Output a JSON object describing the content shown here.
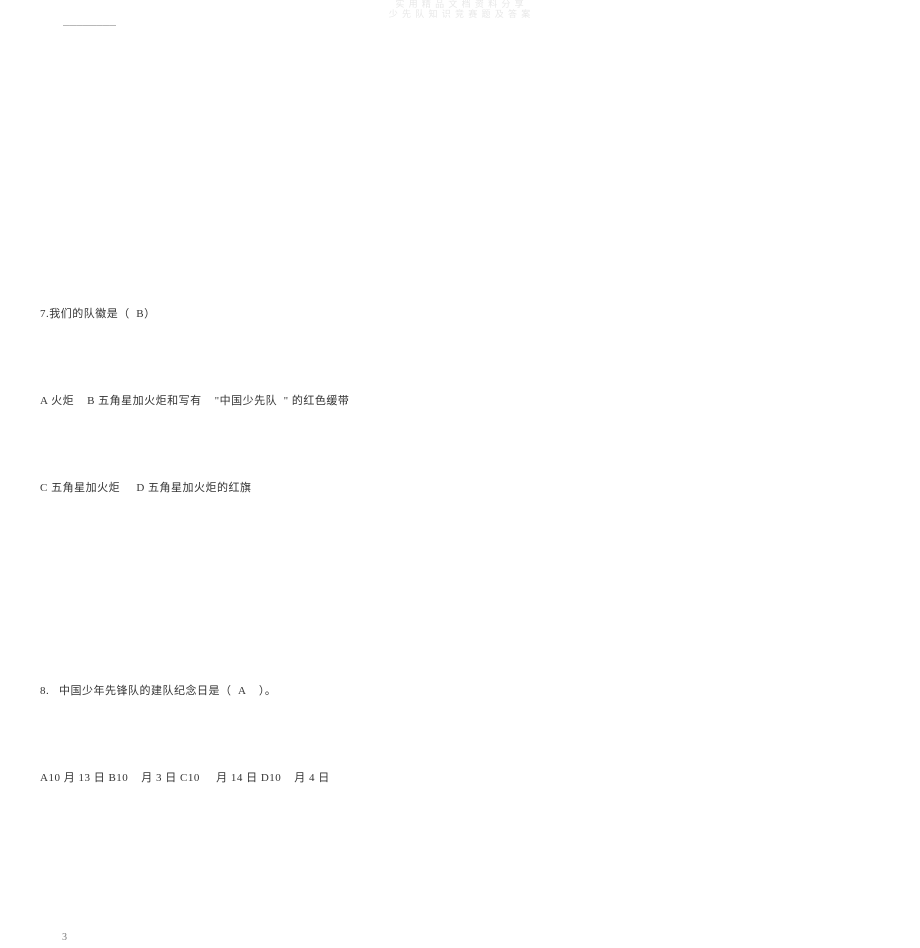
{
  "watermark": {
    "line1": "实 用 精 品 文 档 资 料 分 享",
    "line2": "少 先 队 知 识 竞 赛 题 及 答 案"
  },
  "top_underline": "________",
  "q7": {
    "stem": "7.我们的队徽是（  B）",
    "options_line1": "A 火炬    B 五角星加火炬和写有    \"中国少先队  \" 的红色缓带",
    "options_line2": "C 五角星加火炬     D 五角星加火炬的红旗"
  },
  "q8": {
    "stem": "8.   中国少年先锋队的建队纪念日是（  A    ）。",
    "options": "A10 月 13 日 B10    月 3 日 C10     月 14 日 D10    月 4 日"
  },
  "page_number": "3"
}
